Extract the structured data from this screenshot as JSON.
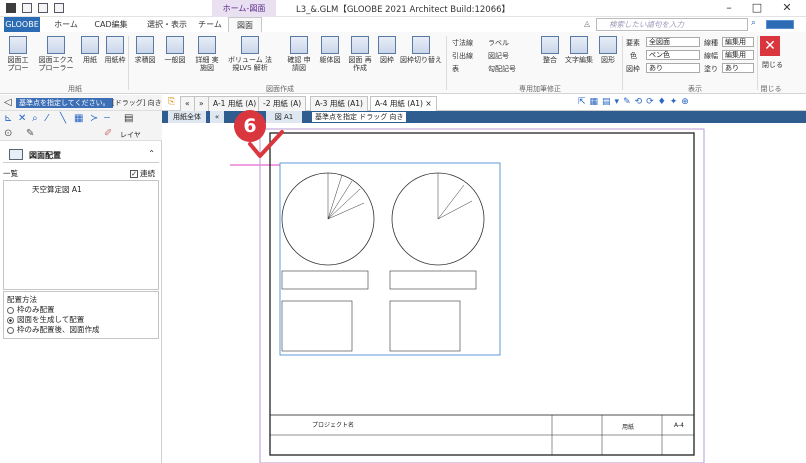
{
  "window": {
    "title": "L3_&.GLM【GLOOBE 2021 Architect Build:12066】",
    "context_tab_label": "ホーム-図面",
    "controls": [
      "–",
      "□",
      "✕"
    ]
  },
  "ribbon_tabs": [
    {
      "label": "GLOOBE"
    },
    {
      "label": "ホーム"
    },
    {
      "label": "CAD編集"
    },
    {
      "label": "選択・表示"
    },
    {
      "label": "チーム"
    },
    {
      "label": "図面"
    }
  ],
  "search": {
    "placeholder": "検索したい語句を入力"
  },
  "ribbon": {
    "groups": {
      "paper": "用紙",
      "drawing": "図面作成",
      "annotation": "専用加筆修正",
      "display": "表示",
      "close": "閉じる"
    },
    "buttons": {
      "zumen_frame": "図面工 プロー",
      "zumen_explorer": "図面エクス プローラー",
      "paper": "用紙",
      "paper_frame": "用紙枠",
      "plan_view": "求積図",
      "general_view": "一般図",
      "detail_view": "詳細 実施図",
      "volume_analysis": "ボリューム 法規LVS 解析",
      "confirm_shinsei": "確認 申請図",
      "frame_view": "躯体図",
      "redraw": "図面 再作成",
      "frame": "図枠",
      "frame_switch": "図枠切り替え",
      "dim_line": "寸法線",
      "label": "ラベル",
      "leader": "引出線",
      "symbol": "図記号",
      "table": "表",
      "slope_symbol": "勾配記号",
      "align": "整合",
      "text_edit": "文字編集",
      "shape": "図形",
      "close": "閉じる"
    },
    "props": {
      "layer_label": "要素",
      "layer_value": "全図面",
      "color_label": "色",
      "color_value": "ペン色",
      "frame_label": "図枠",
      "frame_value": "あり",
      "line_label": "線種",
      "line_value": "編集用",
      "line2_label": "線幅",
      "line2_value": "編集用",
      "fill_label": "塗り",
      "fill_value": "あり"
    }
  },
  "prompt": {
    "text": "基準点を指定してください。",
    "hint": "[ドラッグ] 向き"
  },
  "layer_toolbar": {
    "label": "レイヤ"
  },
  "panel": {
    "title": "図面配置",
    "list_label": "一覧",
    "continuous_label": "連続",
    "continuous_checked": true,
    "items": [
      "天空算定図 A1"
    ],
    "method_title": "配置方法",
    "methods": [
      {
        "label": "枠のみ配置",
        "selected": false
      },
      {
        "label": "図面を生成して配置",
        "selected": true
      },
      {
        "label": "枠のみ配置後、図面作成",
        "selected": false
      }
    ]
  },
  "doc_tabs": [
    {
      "label": "A-1 用紙 (A)"
    },
    {
      "label": "-2 用紙 (A)"
    },
    {
      "label": "A-3 用紙 (A1)"
    },
    {
      "label": "A-4 用紙 (A1)"
    }
  ],
  "sub_bar": {
    "left": "用紙全体",
    "hint": "基準点を指定 ドラッグ 向き",
    "small_tab": "図 A1"
  },
  "drawing": {
    "title_block_project": "プロジェクト名",
    "title_block_sheet": "用紙",
    "title_block_no": "A-4"
  },
  "callout": {
    "number": "6"
  },
  "colors": {
    "accent": "#2b6cb4",
    "callout": "#d9363e",
    "sheet_border": "#b89ad6",
    "placement": "#5b9bd5"
  }
}
